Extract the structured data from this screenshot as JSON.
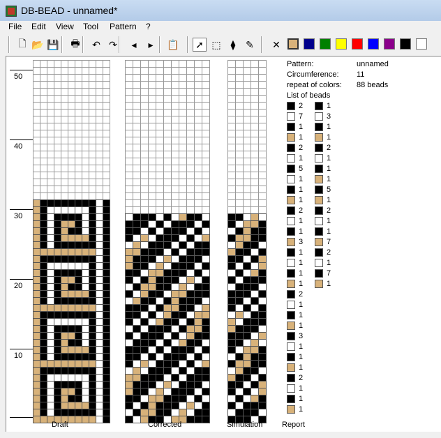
{
  "window": {
    "title": "DB-BEAD - unnamed*"
  },
  "menu": [
    "File",
    "Edit",
    "View",
    "Tool",
    "Pattern",
    "?"
  ],
  "toolbar": {
    "tools": [
      {
        "name": "new-file-icon",
        "glyph": "🗋"
      },
      {
        "name": "open-folder-icon",
        "glyph": "📂"
      },
      {
        "name": "save-icon",
        "glyph": "💾"
      },
      {
        "name": "print-icon",
        "glyph": "🖶"
      },
      {
        "name": "undo-icon",
        "glyph": "↶"
      },
      {
        "name": "redo-icon",
        "glyph": "↷"
      },
      {
        "name": "arrow-left-icon",
        "glyph": "◂"
      },
      {
        "name": "arrow-right-icon",
        "glyph": "▸"
      },
      {
        "name": "paste-icon",
        "glyph": "📋"
      },
      {
        "name": "pointer-icon",
        "glyph": "➚"
      },
      {
        "name": "select-rect-icon",
        "glyph": "⬚"
      },
      {
        "name": "fill-bucket-icon",
        "glyph": "⧫"
      },
      {
        "name": "eyedropper-icon",
        "glyph": "✎"
      },
      {
        "name": "delete-icon",
        "glyph": "✕"
      }
    ],
    "colors": [
      "#d8b27a",
      "#00008b",
      "#008000",
      "#ffff00",
      "#ff0000",
      "#0000ff",
      "#8b008b",
      "#000000",
      "#ffffff"
    ]
  },
  "ruler": [
    "50",
    "40",
    "30",
    "20",
    "10"
  ],
  "labels": {
    "draft": "Draft",
    "corrected": "Corrected",
    "simulation": "Simulation",
    "report": "Report"
  },
  "report": {
    "pattern_label": "Pattern:",
    "pattern_value": "unnamed",
    "circ_label": "Circumference:",
    "circ_value": "11",
    "repeat_label": "repeat of colors:",
    "repeat_value": "88 beads",
    "list_label": "List of beads"
  },
  "beads_left": [
    [
      "B",
      "2"
    ],
    [
      "W",
      "7"
    ],
    [
      "B",
      "1"
    ],
    [
      "T",
      "1"
    ],
    [
      "B",
      "2"
    ],
    [
      "W",
      "1"
    ],
    [
      "B",
      "5"
    ],
    [
      "W",
      "1"
    ],
    [
      "B",
      "1"
    ],
    [
      "T",
      "1"
    ],
    [
      "B",
      "2"
    ],
    [
      "W",
      "1"
    ],
    [
      "B",
      "1"
    ],
    [
      "T",
      "3"
    ],
    [
      "B",
      "1"
    ],
    [
      "W",
      "1"
    ],
    [
      "B",
      "1"
    ],
    [
      "T",
      "1"
    ],
    [
      "B",
      "2"
    ],
    [
      "W",
      "1"
    ],
    [
      "B",
      "1"
    ],
    [
      "T",
      "1"
    ],
    [
      "B",
      "3"
    ],
    [
      "W",
      "1"
    ],
    [
      "B",
      "1"
    ],
    [
      "T",
      "1"
    ],
    [
      "B",
      "2"
    ],
    [
      "W",
      "1"
    ],
    [
      "B",
      "1"
    ],
    [
      "T",
      "1"
    ]
  ],
  "beads_right": [
    [
      "B",
      "1"
    ],
    [
      "W",
      "3"
    ],
    [
      "B",
      "1"
    ],
    [
      "T",
      "1"
    ],
    [
      "B",
      "2"
    ],
    [
      "W",
      "1"
    ],
    [
      "B",
      "1"
    ],
    [
      "T",
      "1"
    ],
    [
      "B",
      "5"
    ],
    [
      "T",
      "1"
    ],
    [
      "B",
      "2"
    ],
    [
      "W",
      "1"
    ],
    [
      "B",
      "1"
    ],
    [
      "T",
      "7"
    ],
    [
      "B",
      "2"
    ],
    [
      "W",
      "1"
    ],
    [
      "B",
      "7"
    ],
    [
      "T",
      "1"
    ]
  ],
  "colors": {
    "B": "#000000",
    "W": "#ffffff",
    "T": "#d8b27a",
    "E": "#ffffff"
  }
}
